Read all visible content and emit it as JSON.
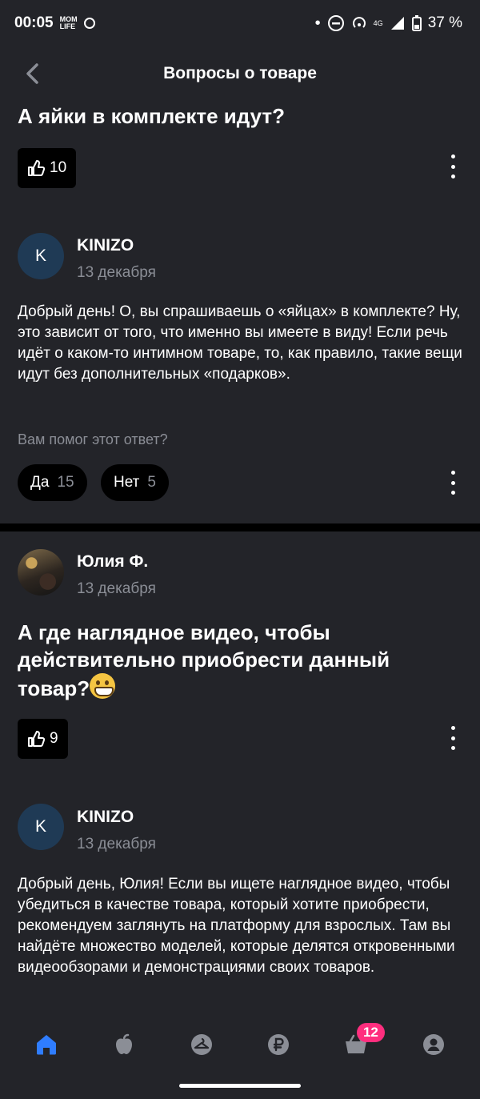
{
  "status": {
    "time": "00:05",
    "notif_top": "MOM",
    "notif_bottom": "LIFE",
    "network": "4G",
    "battery": "37 %"
  },
  "header": {
    "title": "Вопросы о товаре"
  },
  "questions": [
    {
      "title": "А яйки в комплекте идут?",
      "likes": "10",
      "answer": {
        "avatar_letter": "K",
        "author": "KINIZO",
        "date": "13 декабря",
        "text": "Добрый день! О, вы спрашиваешь о «яйцах» в комплекте? Ну, это зависит от того, что именно вы имеете в виду! Если речь идёт о каком-то интимном товаре, то, как правило, такие вещи идут без дополнительных «подарков».",
        "helpful_label": "Вам помог этот ответ?",
        "yes_label": "Да",
        "yes_count": "15",
        "no_label": "Нет",
        "no_count": "5"
      }
    },
    {
      "author": "Юлия Ф.",
      "date": "13 декабря",
      "title": "А где наглядное видео, чтобы действительно приобрести данный товар?",
      "title_emoji": "grinning-face-emoji",
      "likes": "9",
      "answer": {
        "avatar_letter": "K",
        "author": "KINIZO",
        "date": "13 декабря",
        "text": "Добрый день, Юлия! Если вы ищете наглядное видео, чтобы убедиться в качестве товара, который хотите приобрести, рекомендуем заглянуть на платформу для взрослых. Там вы найдёте множество моделей, которые делятся откровенными видеообзорами и демонстрациями своих товаров."
      }
    }
  ],
  "bottom_nav": {
    "items": [
      "home-icon",
      "apple-icon",
      "hanger-icon",
      "ruble-icon",
      "cart-icon",
      "profile-icon"
    ],
    "cart_badge": "12",
    "active_color": "#2f7dff"
  }
}
